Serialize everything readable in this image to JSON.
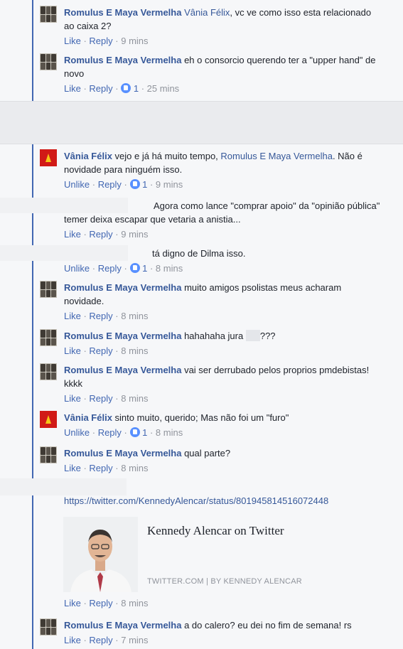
{
  "comments": [
    {
      "author": "Romulus E Maya Vermelha",
      "mention": "Vânia Félix",
      "text": ", vc ve como isso esta relacionado ao caixa 2?",
      "like": "Like",
      "reply": "Reply",
      "time": "9 mins"
    },
    {
      "author": "Romulus E Maya Vermelha",
      "text": "eh o consorcio querendo ter a \"upper hand\" de novo",
      "like": "Like",
      "reply": "Reply",
      "reactions": "1",
      "time": "25 mins"
    },
    {
      "author": "Vânia Félix",
      "text_before": "vejo e já há muito tempo,",
      "mention": "Romulus E Maya Vermelha",
      "text_after": ". Não é novidade para ninguém isso.",
      "like": "Unlike",
      "reply": "Reply",
      "reactions": "1",
      "time": "9 mins"
    },
    {
      "text": "Agora como lance \"comprar apoio\" da \"opinião pública\" temer deixa escapar que vetaria a anistia...",
      "like": "Like",
      "reply": "Reply",
      "time": "9 mins"
    },
    {
      "text": "tá digno de Dilma isso.",
      "like": "Unlike",
      "reply": "Reply",
      "reactions": "1",
      "time": "8 mins"
    },
    {
      "author": "Romulus E Maya Vermelha",
      "text": "muito amigos psolistas meus acharam novidade.",
      "like": "Like",
      "reply": "Reply",
      "time": "8 mins"
    },
    {
      "author": "Romulus E Maya Vermelha",
      "text": "hahahaha jura",
      "text_tail": "???",
      "like": "Like",
      "reply": "Reply",
      "time": "8 mins"
    },
    {
      "author": "Romulus E Maya Vermelha",
      "text": "vai ser derrubado pelos proprios pmdebistas! kkkk",
      "like": "Like",
      "reply": "Reply",
      "time": "8 mins"
    },
    {
      "author": "Vânia Félix",
      "text": "sinto muito, querido; Mas não foi um \"furo\"",
      "like": "Unlike",
      "reply": "Reply",
      "reactions": "1",
      "time": "8 mins"
    },
    {
      "author": "Romulus E Maya Vermelha",
      "text": "qual parte?",
      "like": "Like",
      "reply": "Reply",
      "time": "8 mins"
    },
    {
      "link": "https://twitter.com/KennedyAlencar/status/801945814516072448",
      "card_title": "Kennedy Alencar on Twitter",
      "card_source": "TWITTER.COM | BY KENNEDY ALENCAR",
      "like": "Like",
      "reply": "Reply",
      "time": "8 mins"
    },
    {
      "author": "Romulus E Maya Vermelha",
      "text": "a do calero? eu dei no fim de semana! rs",
      "like": "Like",
      "reply": "Reply",
      "time": "7 mins"
    }
  ]
}
